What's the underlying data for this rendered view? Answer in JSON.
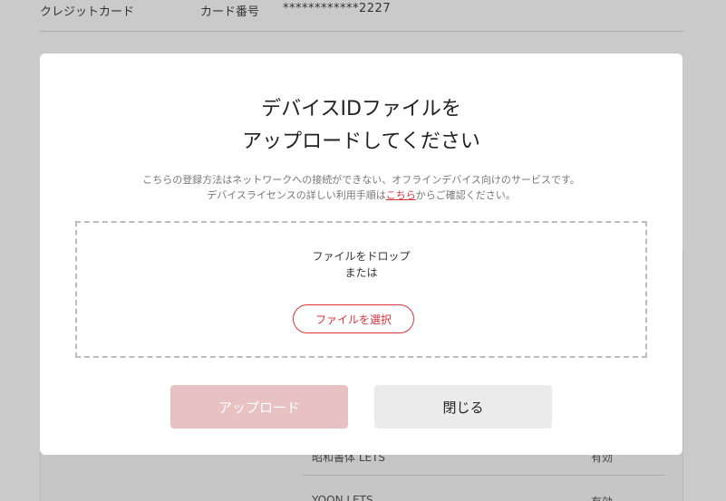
{
  "background": {
    "payment": {
      "label": "クレジットカード",
      "card_number_label": "カード番号",
      "card_number_value": "************2227"
    },
    "fonts": [
      {
        "name": "昭和書体 LETS",
        "status": "有効"
      },
      {
        "name": "YOON LETS",
        "status": "有効"
      }
    ]
  },
  "modal": {
    "title_line1": "デバイスIDファイルを",
    "title_line2": "アップロードしてください",
    "desc_line1": "こちらの登録方法はネットワークへの接続ができない、オフラインデバイス向けのサービスです。",
    "desc_line2_before": "デバイスライセンスの詳しい利用手順は",
    "desc_link": "こちら",
    "desc_line2_after": "からご確認ください。",
    "drop_line1": "ファイルをドロップ",
    "drop_line2": "または",
    "select_file_label": "ファイルを選択",
    "upload_label": "アップロード",
    "close_label": "閉じる"
  },
  "colors": {
    "accent": "#d9343a",
    "upload_disabled": "#e8c1c2",
    "close_bg": "#ebebeb",
    "overlay_bg": "#cacaca"
  }
}
